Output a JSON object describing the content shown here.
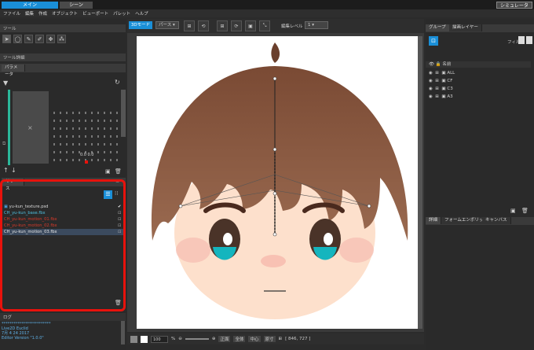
{
  "top_tabs": {
    "main": "メイン",
    "scene": "シーン",
    "simulate": "シミュレータ"
  },
  "menu": [
    "ファイル",
    "編集",
    "作成",
    "オブジェクト",
    "ビューポート",
    "パレット",
    "ヘルプ"
  ],
  "tool_panel": {
    "title": "ツール",
    "detail_title": "ツール詳細"
  },
  "param_panel": {
    "tab": "パラメータ",
    "grid_value": "0.0  0.0",
    "center_x": "×"
  },
  "resource_panel": {
    "tab": "リソース",
    "items": [
      {
        "name": "yu-kun_texture.psd",
        "color": "#d8d8d8"
      },
      {
        "name": "CH_yu-kun_base.fbx",
        "color": "#4ec0e0"
      },
      {
        "name": "CH_yu-kun_motion_01.fbx",
        "color": "#d93a2a"
      },
      {
        "name": "CH_yu-kun_motion_02.fbx",
        "color": "#d93a2a"
      },
      {
        "name": "CH_yu-kun_motion_03.fbx",
        "color": "#e6e6e6"
      }
    ]
  },
  "log_panel": {
    "title": "ログ",
    "lines": [
      "*************************",
      "Live2D Euclid",
      "7月 4 24 2017",
      "Editor Version \"1.0.0\""
    ]
  },
  "viewport_toolbar": {
    "mode": "3Dモード",
    "perspective": "パース",
    "edit_level_label": "編集レベル",
    "edit_level_value": "1"
  },
  "bottom_bar": {
    "zoom": "100",
    "zoom_unit": "%",
    "front": "正面",
    "whole": "全体",
    "center": "中心",
    "original": "原寸",
    "coords": "[ 846, 727 ]"
  },
  "group_panel": {
    "tabs": [
      "グループ",
      "描画レイヤー"
    ],
    "filter_label": "フィルタ",
    "name_header": "名前",
    "items": [
      "ALL",
      "CF",
      "C3",
      "A3"
    ]
  },
  "detail_panel": {
    "tabs": [
      "詳細",
      "フォームエンボリット",
      "キャンバス"
    ]
  },
  "colors": {
    "accent_blue": "#1a8fd8",
    "highlight_red": "#e8120c"
  }
}
